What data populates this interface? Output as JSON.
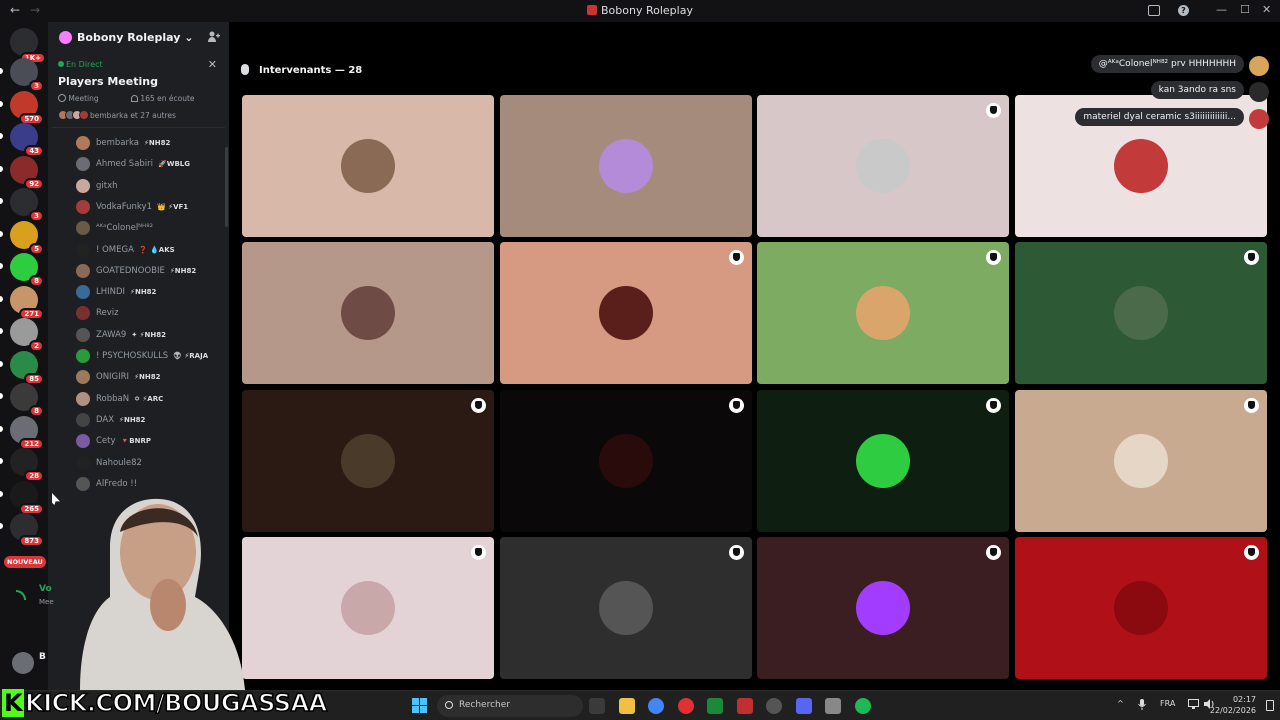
{
  "window": {
    "title": "Bobony Roleplay",
    "back_glyph": "←",
    "forward_glyph": "→",
    "inbox_icon": "inbox-icon",
    "help_glyph": "?",
    "min_glyph": "—",
    "max_glyph": "☐",
    "close_glyph": "✕"
  },
  "rail": {
    "home_badge": "1K+",
    "badges": [
      "3",
      "570",
      "43",
      "92",
      "3",
      "5",
      "8",
      "271",
      "2",
      "85",
      "8",
      "212",
      "28",
      "265",
      "873"
    ],
    "new_label": "NOUVEAU"
  },
  "sidebar": {
    "guild_name": "Bobony Roleplay",
    "guild_chevron": "⌄",
    "live_label": "En Direct",
    "event_title": "Players Meeting",
    "close_glyph": "✕",
    "meta_type": "Meeting",
    "meta_listening": "165 en écoute",
    "meta_people": "bembarka et 27 autres",
    "members": [
      {
        "name": "bembarka",
        "tag": "⚡NH82",
        "color": "#b07a5a"
      },
      {
        "name": "Ahmed Sabiri",
        "tag": "🚀WBLG",
        "color": "#6a6d73"
      },
      {
        "name": "gitxh",
        "tag": "",
        "color": "#c9a8a0"
      },
      {
        "name": "VodkaFunky1",
        "tag": "👑 ⚡VF1",
        "color": "#a33b3b"
      },
      {
        "name": "ᴬᴷᵃColonelᴺᴴ⁸²",
        "tag": "",
        "color": "#6a5a4a"
      },
      {
        "name": "! OMEGA",
        "tag": "❓ 💧AKS",
        "color": "#222"
      },
      {
        "name": "GOATEDNOOBIE",
        "tag": "⚡NH82",
        "color": "#8a6a55"
      },
      {
        "name": "LHINDI",
        "tag": "⚡NH82",
        "color": "#3a6a9a"
      },
      {
        "name": "Reviz",
        "tag": "",
        "color": "#7a3030"
      },
      {
        "name": "ZAWA9",
        "tag": "✦ ⚡NH82",
        "color": "#555"
      },
      {
        "name": "! PSYCHOSKULLS",
        "tag": "👽 ⚡RAJA",
        "color": "#2a9a3a"
      },
      {
        "name": "ONIGIRI",
        "tag": "⚡NH82",
        "color": "#9a7a5a"
      },
      {
        "name": "RobbaN",
        "tag": "✡ ⚡ARC",
        "color": "#b09080"
      },
      {
        "name": "DAX",
        "tag": "⚡NH82",
        "color": "#444"
      },
      {
        "name": "Cety",
        "tag": "🔻BNRP",
        "color": "#7a5aa0"
      },
      {
        "name": "Nahoule82",
        "tag": "",
        "color": "#222"
      },
      {
        "name": "AlFredo !!",
        "tag": "",
        "color": "#555"
      }
    ]
  },
  "main": {
    "speakers_label": "Intervenants — 28",
    "tiles": [
      {
        "bg": "#d7b8a9",
        "avatar": "#8a6a55",
        "shield": false
      },
      {
        "bg": "#a48b7c",
        "avatar": "#b38bd8",
        "shield": false
      },
      {
        "bg": "#d7c7c9",
        "avatar": "#c9c9c9",
        "shield": true
      },
      {
        "bg": "#eee1e2",
        "avatar": "#c23a3a",
        "shield": false
      },
      {
        "bg": "#b5988a",
        "avatar": "#6e4c45",
        "shield": false
      },
      {
        "bg": "#d69a82",
        "avatar": "#5a1f1a",
        "shield": true
      },
      {
        "bg": "#7eab62",
        "avatar": "#d9a56a",
        "shield": true
      },
      {
        "bg": "#2d5a34",
        "avatar": "#4a6a4a",
        "shield": true
      },
      {
        "bg": "#2a1a13",
        "avatar": "#4a3a2a",
        "shield": true
      },
      {
        "bg": "#0a0808",
        "avatar": "#2a0b0b",
        "shield": true
      },
      {
        "bg": "#0e1e10",
        "avatar": "#2ecc40",
        "shield": true
      },
      {
        "bg": "#c8aa90",
        "avatar": "#e6d6c6",
        "shield": true
      },
      {
        "bg": "#e4d3d6",
        "avatar": "#c9a8aa",
        "shield": true
      },
      {
        "bg": "#2e2e2e",
        "avatar": "#555555",
        "shield": true
      },
      {
        "bg": "#3a1e22",
        "avatar": "#a23cff",
        "shield": true
      },
      {
        "bg": "#b01018",
        "avatar": "#8a0a10",
        "shield": true
      }
    ],
    "bubbles": [
      {
        "text": "@ᴬᴷᵃColonelᴺᴴ⁸² prv HHHHHHH",
        "avatar": "#d9a55a"
      },
      {
        "text": "kan 3ando ra sns",
        "avatar": "#2a2a2a"
      },
      {
        "text": "materiel dyal ceramic s3iiiiiiiiiiiii...",
        "avatar": "#c23a3a"
      }
    ]
  },
  "taskbar": {
    "search_placeholder": "Rechercher",
    "lang": "FRA",
    "time": "02:17",
    "date": "22/02/2026",
    "tray_up": "^",
    "mic_glyph": "🎙",
    "net_glyph": "▭",
    "vol_glyph": "🔊",
    "apps": [
      "file-icon",
      "folder-icon",
      "chrome-icon",
      "opera-icon",
      "terminal-icon",
      "app-a-icon",
      "obs-icon",
      "discord-icon",
      "desktop-icon",
      "spotify-icon"
    ]
  },
  "overlay": {
    "kick_k": "K",
    "kick_text": "KICK.COM/BOUGASSAA",
    "voice_label": "Vo",
    "voice_sub": "Mee",
    "user_initial": "B"
  },
  "colors": {
    "accent": "#5865f2",
    "badge": "#da373c",
    "kick": "#53fc18",
    "online": "#23a55a"
  }
}
